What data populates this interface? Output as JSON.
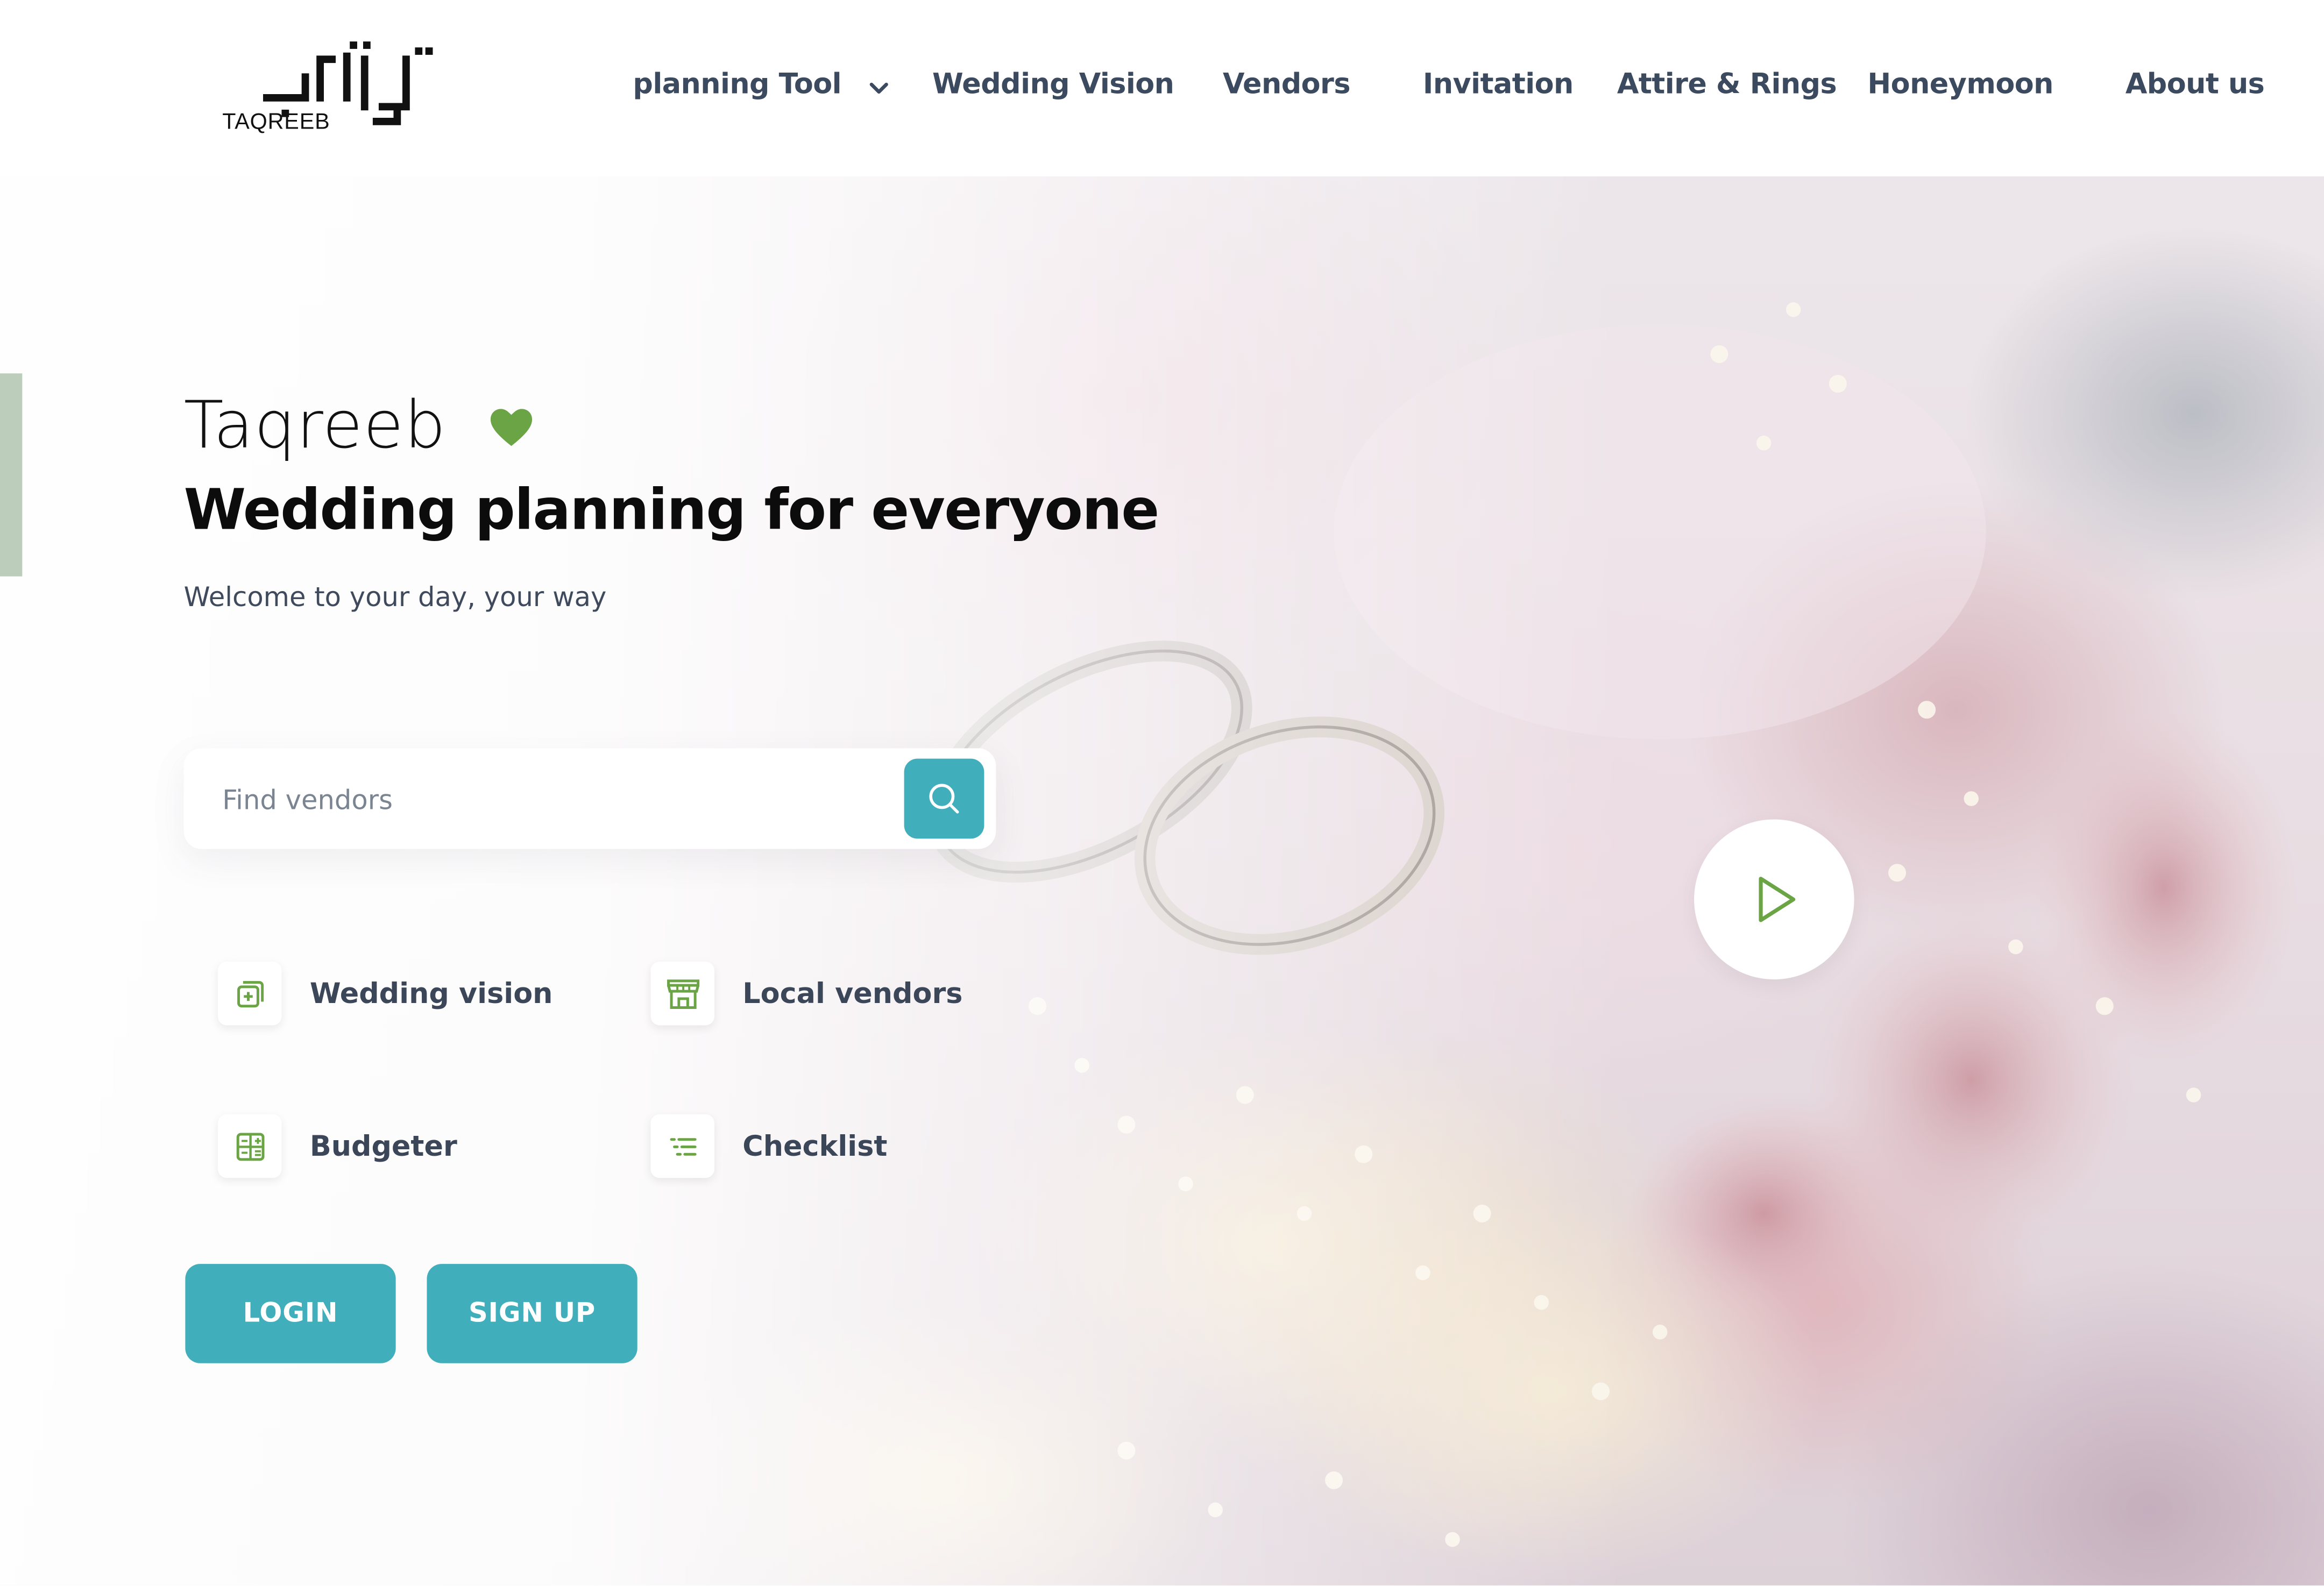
{
  "brand": {
    "logo_text": "TAQREEB"
  },
  "nav": {
    "items": [
      {
        "label": "planning Tool"
      },
      {
        "label": "Wedding Vision"
      },
      {
        "label": "Vendors"
      },
      {
        "label": "Invitation"
      },
      {
        "label": "Attire & Rings"
      },
      {
        "label": "Honeymoon"
      },
      {
        "label": "About us"
      }
    ]
  },
  "hero": {
    "brand_name": "Taqreeb",
    "headline": "Wedding planning for everyone",
    "subline": "Welcome to your day, your way",
    "search": {
      "placeholder": "Find vendors"
    },
    "features": [
      {
        "label": "Wedding vision",
        "icon": "image-plus-icon"
      },
      {
        "label": "Local vendors",
        "icon": "store-icon"
      },
      {
        "label": "Budgeter",
        "icon": "calculator-icon"
      },
      {
        "label": "Checklist",
        "icon": "list-icon"
      }
    ],
    "login_label": "LOGIN",
    "signup_label": "SIGN UP"
  },
  "colors": {
    "accent": "#41aebb",
    "green": "#6aa444",
    "nav_text": "#3c4a5f",
    "side_tab": "#bccdbc"
  }
}
